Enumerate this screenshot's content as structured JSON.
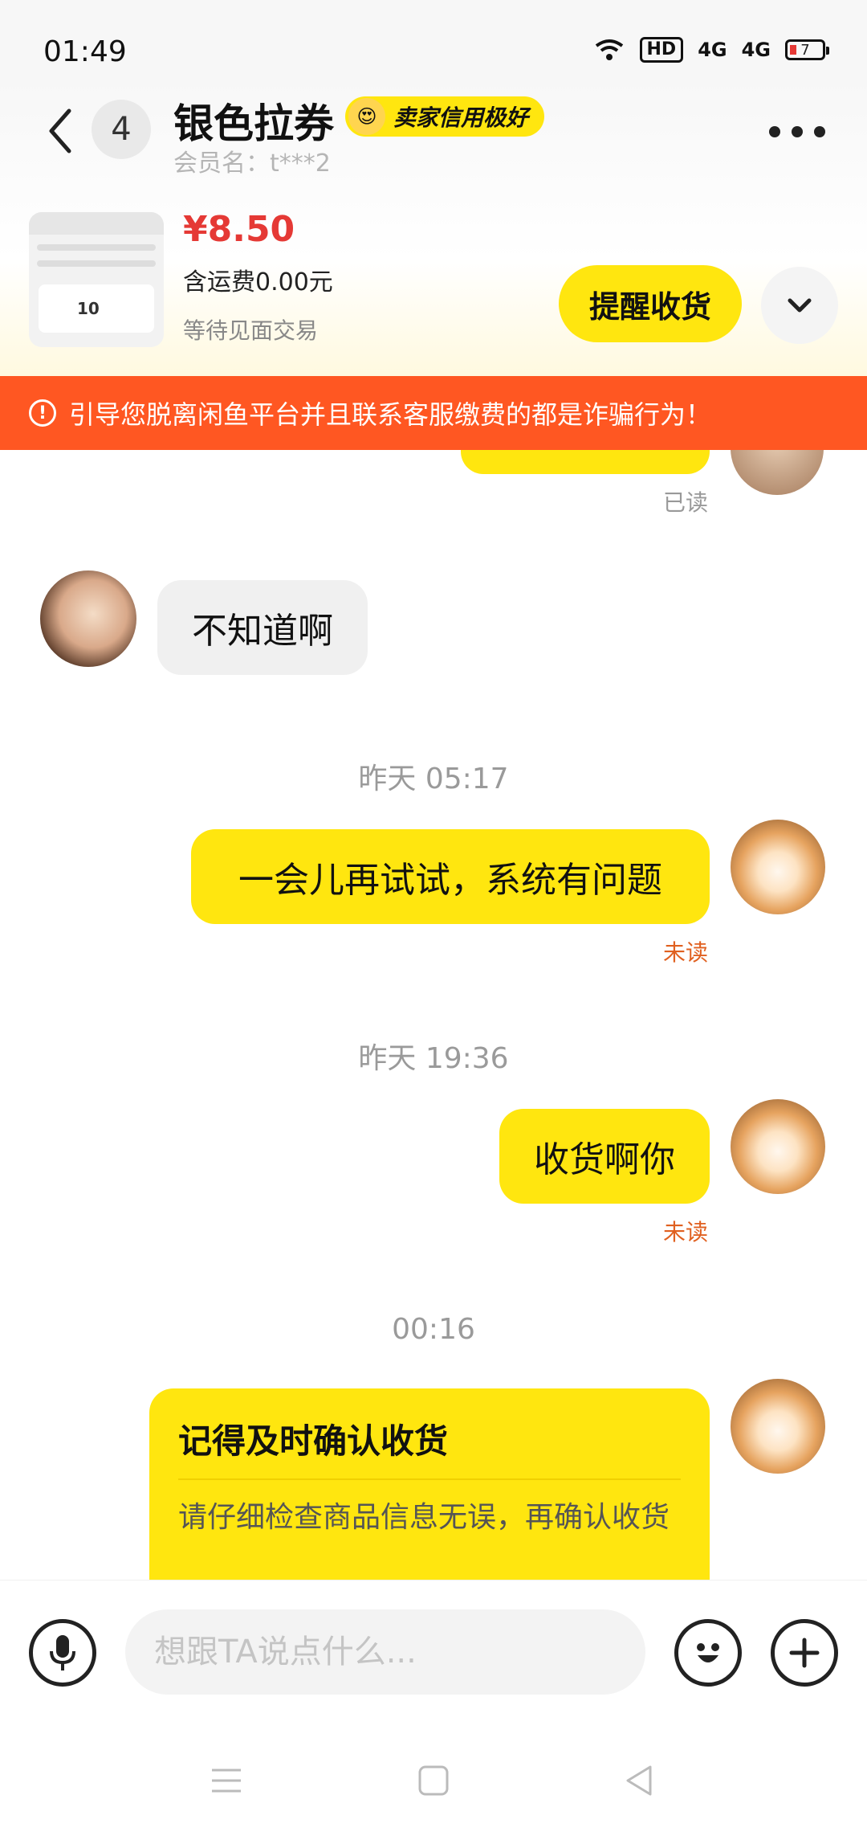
{
  "status_bar": {
    "time": "01:49",
    "hd": "HD",
    "network1": "4G",
    "network2": "4G",
    "battery": "7"
  },
  "header": {
    "unread_count": "4",
    "seller_name": "银色拉券",
    "credit_badge": "卖家信用极好",
    "member_name": "会员名：t***2"
  },
  "product": {
    "price": "¥8.50",
    "shipping": "含运费0.00元",
    "trade_status": "等待见面交易",
    "thumb_value": "10",
    "remind_button": "提醒收货"
  },
  "warning": {
    "text": "引导您脱离闲鱼平台并且联系客服缴费的都是诈骗行为！"
  },
  "messages": [
    {
      "status": "已读"
    },
    {
      "text": "不知道啊"
    },
    {
      "time": "昨天 05:17",
      "text": "一会儿再试试，系统有问题",
      "status": "未读"
    },
    {
      "time": "昨天 19:36",
      "text": "收货啊你",
      "status": "未读"
    },
    {
      "time": "00:16",
      "card_title": "记得及时确认收货",
      "card_body": "请仔细检查商品信息无误，再确认收货"
    }
  ],
  "input": {
    "placeholder": "想跟TA说点什么..."
  },
  "colors": {
    "accent": "#ffe60f",
    "warning": "#ff5722",
    "price": "#e53935",
    "unread": "#e06020"
  }
}
